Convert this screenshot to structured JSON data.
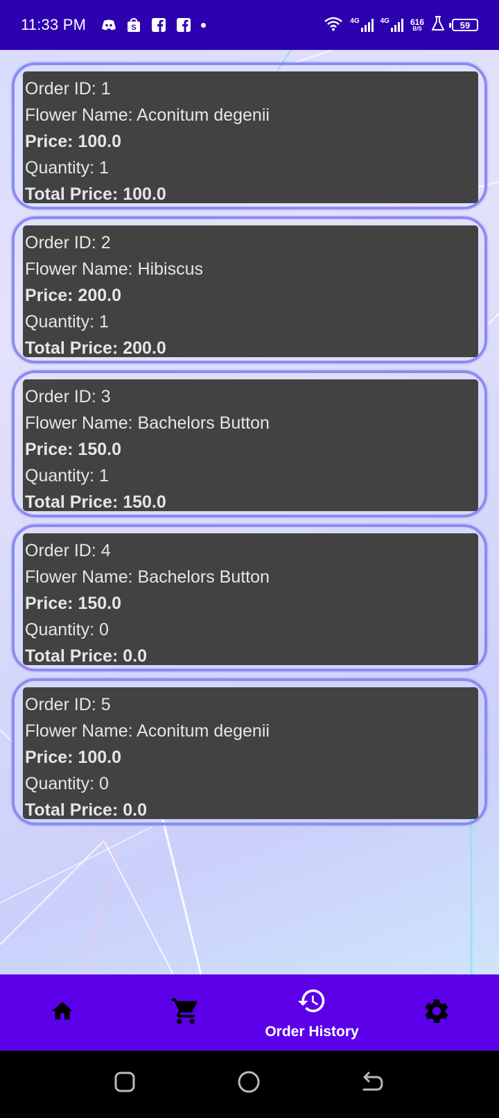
{
  "status_bar": {
    "time": "11:33 PM",
    "network_1": "4G",
    "network_2": "4G",
    "speed_value": "616",
    "speed_unit": "B/S",
    "battery": "59"
  },
  "orders": [
    {
      "order_id": "Order ID: 1",
      "flower_name": "Flower Name: Aconitum degenii",
      "price": "Price: 100.0",
      "quantity": "Quantity: 1",
      "total_price": "Total Price: 100.0"
    },
    {
      "order_id": "Order ID: 2",
      "flower_name": "Flower Name: Hibiscus",
      "price": "Price: 200.0",
      "quantity": "Quantity: 1",
      "total_price": "Total Price: 200.0"
    },
    {
      "order_id": "Order ID: 3",
      "flower_name": "Flower Name: Bachelors Button",
      "price": "Price: 150.0",
      "quantity": "Quantity: 1",
      "total_price": "Total Price: 150.0"
    },
    {
      "order_id": "Order ID: 4",
      "flower_name": "Flower Name: Bachelors Button",
      "price": "Price: 150.0",
      "quantity": "Quantity: 0",
      "total_price": "Total Price: 0.0"
    },
    {
      "order_id": "Order ID: 5",
      "flower_name": "Flower Name: Aconitum degenii",
      "price": "Price: 100.0",
      "quantity": "Quantity: 0",
      "total_price": "Total Price: 0.0"
    }
  ],
  "bottom_nav": {
    "items": [
      {
        "icon": "home-icon",
        "label": ""
      },
      {
        "icon": "cart-icon",
        "label": ""
      },
      {
        "icon": "history-icon",
        "label": "Order History"
      },
      {
        "icon": "settings-icon",
        "label": ""
      }
    ],
    "active_index": 2
  },
  "colors": {
    "status_bar": "#2d00b0",
    "bottom_nav": "#5b00e8",
    "card_border": "#8a8cf0",
    "card_fill": "#424242",
    "card_text": "#e6e6e6"
  }
}
